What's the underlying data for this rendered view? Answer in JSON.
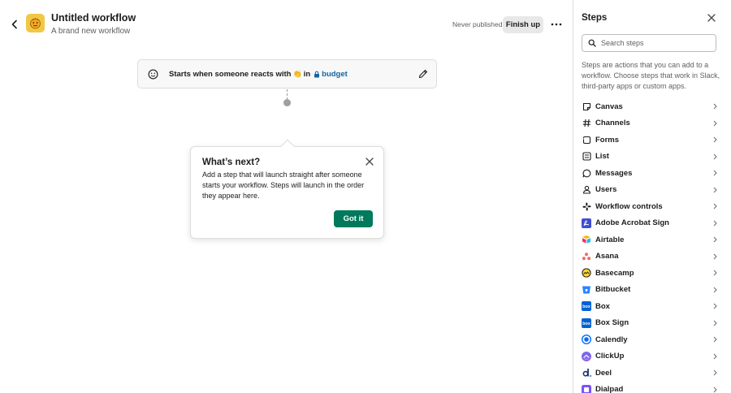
{
  "header": {
    "title": "Untitled workflow",
    "subtitle": "A brand new workflow",
    "publish_status": "Never published",
    "finish_label": "Finish up"
  },
  "trigger": {
    "prefix": "Starts when someone reacts with",
    "in_word": "in",
    "channel": "budget",
    "reaction_emoji": "👏"
  },
  "popover": {
    "title": "What’s next?",
    "body": "Add a step that will launch straight after someone starts your workflow. Steps will launch in the order they appear here.",
    "button_label": "Got it"
  },
  "panel": {
    "title": "Steps",
    "search_placeholder": "Search steps",
    "description": "Steps are actions that you can add to a workflow. Choose steps that work in Slack, third-party apps or custom apps.",
    "items": [
      {
        "label": "Canvas",
        "icon": "canvas-icon"
      },
      {
        "label": "Channels",
        "icon": "hash-icon"
      },
      {
        "label": "Forms",
        "icon": "form-icon"
      },
      {
        "label": "List",
        "icon": "list-icon"
      },
      {
        "label": "Messages",
        "icon": "message-icon"
      },
      {
        "label": "Users",
        "icon": "user-icon"
      },
      {
        "label": "Workflow controls",
        "icon": "slack-icon"
      },
      {
        "label": "Adobe Acrobat Sign",
        "icon": "adobe-sign-icon"
      },
      {
        "label": "Airtable",
        "icon": "airtable-icon"
      },
      {
        "label": "Asana",
        "icon": "asana-icon"
      },
      {
        "label": "Basecamp",
        "icon": "basecamp-icon"
      },
      {
        "label": "Bitbucket",
        "icon": "bitbucket-icon"
      },
      {
        "label": "Box",
        "icon": "box-icon"
      },
      {
        "label": "Box Sign",
        "icon": "box-sign-icon"
      },
      {
        "label": "Calendly",
        "icon": "calendly-icon"
      },
      {
        "label": "ClickUp",
        "icon": "clickup-icon"
      },
      {
        "label": "Deel",
        "icon": "deel-icon"
      },
      {
        "label": "Dialpad",
        "icon": "dialpad-icon"
      }
    ]
  },
  "colors": {
    "accent_green": "#007a5a",
    "link_blue": "#1264a3",
    "text": "#1d1c1d",
    "muted": "#616061"
  }
}
